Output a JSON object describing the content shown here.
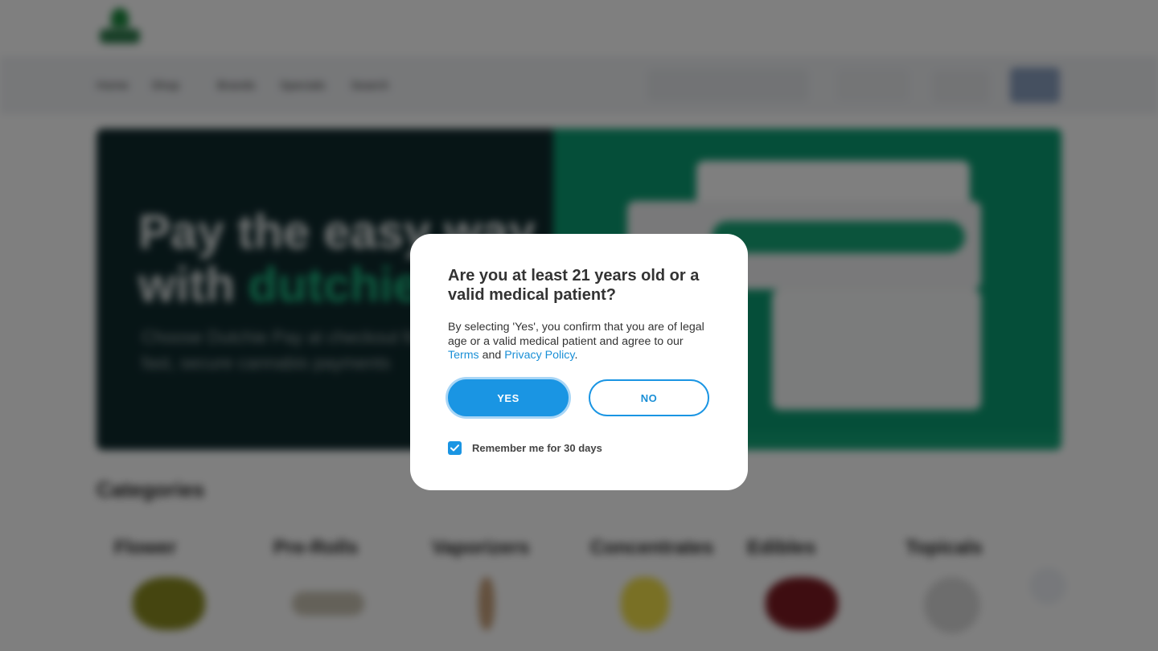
{
  "background": {
    "nav": {
      "items": [
        "Home",
        "Shop",
        "Brands",
        "Specials",
        "Search"
      ]
    },
    "promo": {
      "headline_line1": "Pay the easy way",
      "headline_line2_prefix": "with",
      "headline_line2_accent": "dutchie",
      "subtext_line1": "Choose Dutchie Pay at checkout for",
      "subtext_line2": "fast, secure cannabis payments"
    },
    "categories": {
      "title": "Categories",
      "items": [
        {
          "label": "Flower",
          "color": "#8a8b20"
        },
        {
          "label": "Pre-Rolls",
          "color": "#c9c3b3"
        },
        {
          "label": "Vaporizers",
          "color": "#c7a07a"
        },
        {
          "label": "Concentrates",
          "color": "#f2e04a"
        },
        {
          "label": "Edibles",
          "color": "#7d1b22"
        },
        {
          "label": "Topicals",
          "color": "#dadada"
        }
      ]
    }
  },
  "age_gate": {
    "title": "Are you at least 21 years old or a valid medical patient?",
    "body_prefix": "By selecting 'Yes', you confirm that you are of legal age or a valid medical patient and agree to our ",
    "terms_link": "Terms",
    "body_and": " and ",
    "privacy_link": "Privacy Policy",
    "body_suffix": ".",
    "yes_label": "YES",
    "no_label": "NO",
    "remember_label": "Remember me for 30 days",
    "remember_checked": true,
    "accent_color": "#1a95e3"
  }
}
